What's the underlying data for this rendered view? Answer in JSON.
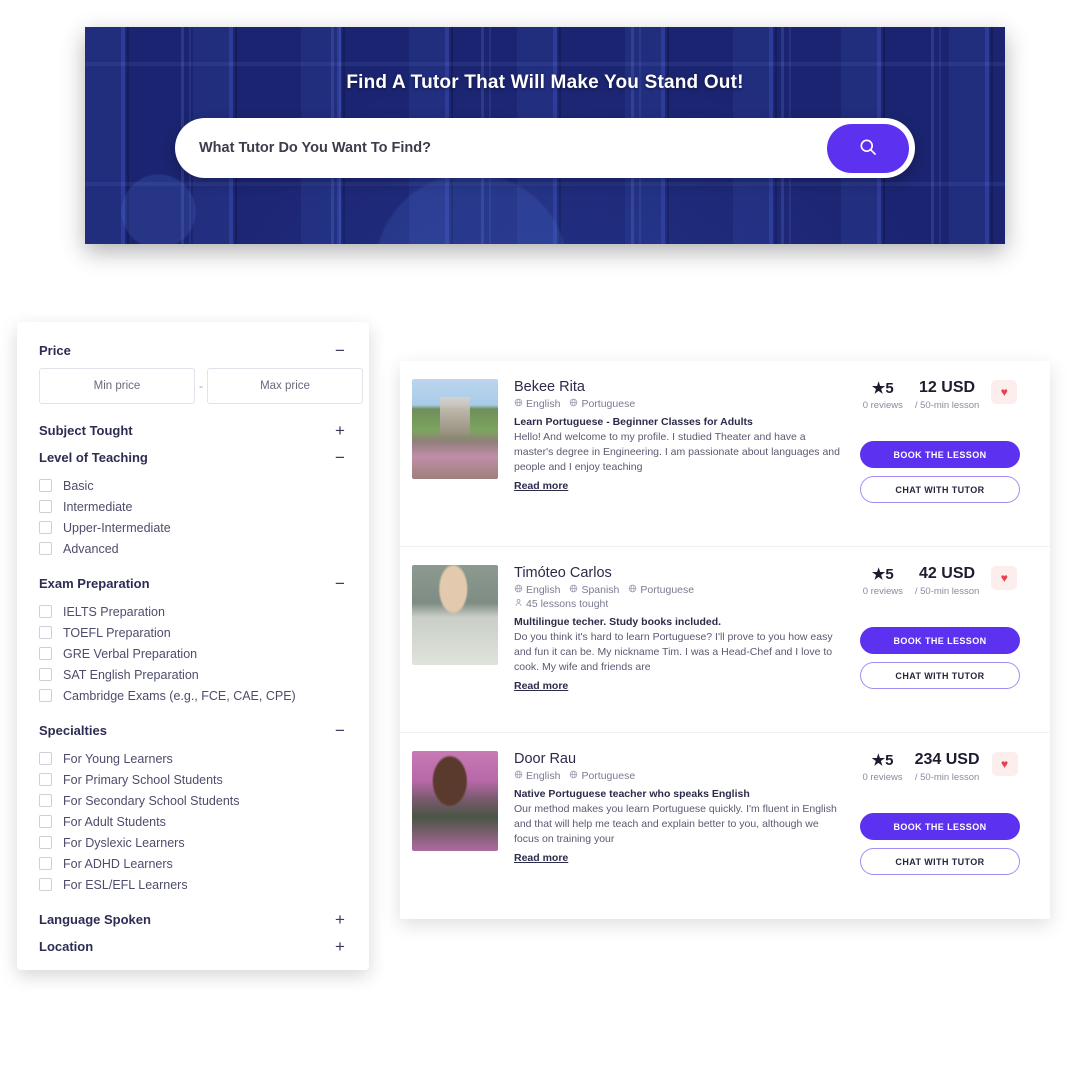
{
  "hero": {
    "title": "Find A Tutor That Will Make You Stand Out!",
    "search_placeholder": "What Tutor Do You Want To Find?",
    "search_value": "",
    "search_icon": "search-icon",
    "accent_color": "#5c32f0",
    "banner_color": "#161e62"
  },
  "sidebar": {
    "price": {
      "title": "Price",
      "toggle": "−",
      "min_placeholder": "Min price",
      "max_placeholder": "Max price",
      "min_value": "",
      "max_value": "",
      "separator": "-"
    },
    "groups": [
      {
        "title": "Subject Tought",
        "toggle": "+",
        "items": []
      },
      {
        "title": "Level of Teaching",
        "toggle": "−",
        "items": [
          "Basic",
          "Intermediate",
          "Upper-Intermediate",
          "Advanced"
        ]
      },
      {
        "title": "Exam Preparation",
        "toggle": "−",
        "items": [
          "IELTS Preparation",
          "TOEFL Preparation",
          "GRE Verbal Preparation",
          "SAT English Preparation",
          "Cambridge Exams (e.g., FCE, CAE, CPE)"
        ]
      },
      {
        "title": "Specialties",
        "toggle": "−",
        "items": [
          "For Young Learners",
          "For Primary School Students",
          "For Secondary School Students",
          "For Adult Students",
          "For Dyslexic Learners",
          "For ADHD Learners",
          "For ESL/EFL Learners"
        ]
      },
      {
        "title": "Language Spoken",
        "toggle": "+",
        "items": []
      },
      {
        "title": "Location",
        "toggle": "+",
        "items": []
      }
    ]
  },
  "results": {
    "book_label": "BOOK THE LESSON",
    "chat_label": "CHAT WITH TUTOR",
    "read_more_label": "Read more",
    "favorite_icon": "heart-icon",
    "star_icon": "star-icon",
    "globe_icon": "globe-icon",
    "person_icon": "person-icon",
    "tutors": [
      {
        "name": "Bekee Rita",
        "languages": [
          "English",
          "Portuguese"
        ],
        "lessons_tought": "",
        "headline": "Learn Portuguese - Beginner Classes for Adults",
        "bio": "Hello! And welcome to my profile. I studied Theater and have a master's degree in Engineering. I am passionate about languages and people and I enjoy teaching",
        "rating": "5",
        "reviews": "0 reviews",
        "price": "12 USD",
        "price_sub": "/ 50-min lesson",
        "photo_class": "photo-0"
      },
      {
        "name": "Timóteo Carlos",
        "languages": [
          "English",
          "Spanish",
          "Portuguese"
        ],
        "lessons_tought": "45 lessons tought",
        "headline": "Multilingue techer. Study books included.",
        "bio": "Do you think it's hard to learn Portuguese? I'll prove to you how easy and fun it can be. My nickname Tim. I was a Head-Chef and I love to cook. My wife and friends are",
        "rating": "5",
        "reviews": "0 reviews",
        "price": "42 USD",
        "price_sub": "/ 50-min lesson",
        "photo_class": "photo-1"
      },
      {
        "name": "Door Rau",
        "languages": [
          "English",
          "Portuguese"
        ],
        "lessons_tought": "",
        "headline": "Native Portuguese teacher who speaks English",
        "bio": "Our method makes you learn Portuguese quickly. I'm fluent in English and that will help me teach and explain better to you, although we focus on training your",
        "rating": "5",
        "reviews": "0 reviews",
        "price": "234 USD",
        "price_sub": "/ 50-min lesson",
        "photo_class": "photo-2"
      }
    ]
  }
}
